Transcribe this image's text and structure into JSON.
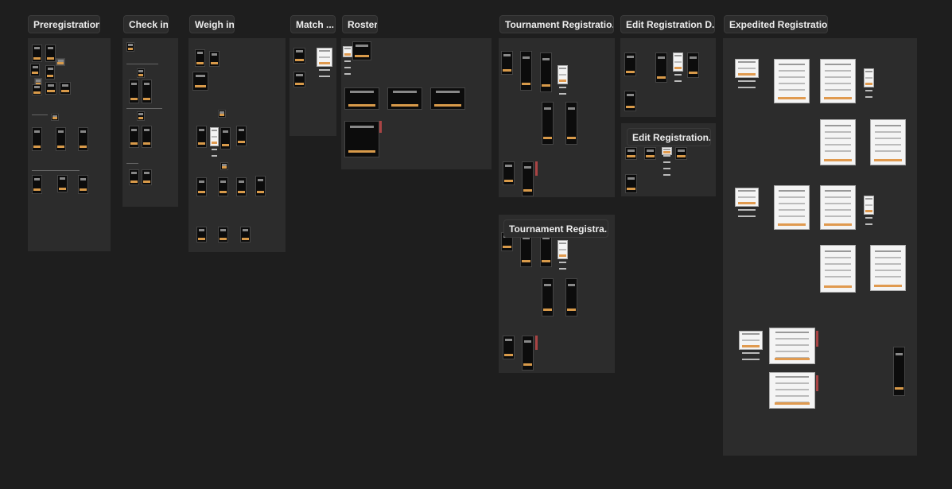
{
  "canvas": {
    "background": "#1e1e1e",
    "section_color": "#2c2c2c",
    "accent": "#d89a4a"
  },
  "sections": [
    {
      "label": "Preregistration"
    },
    {
      "label": "Check in"
    },
    {
      "label": "Weigh in"
    },
    {
      "label": "Match ..."
    },
    {
      "label": "Roster"
    },
    {
      "label": "Tournament Registratio..."
    },
    {
      "label": "Edit Registration D..."
    },
    {
      "label": "Expedited Registration"
    },
    {
      "label": "Edit Registration..."
    },
    {
      "label": "Tournament Registra..."
    }
  ]
}
